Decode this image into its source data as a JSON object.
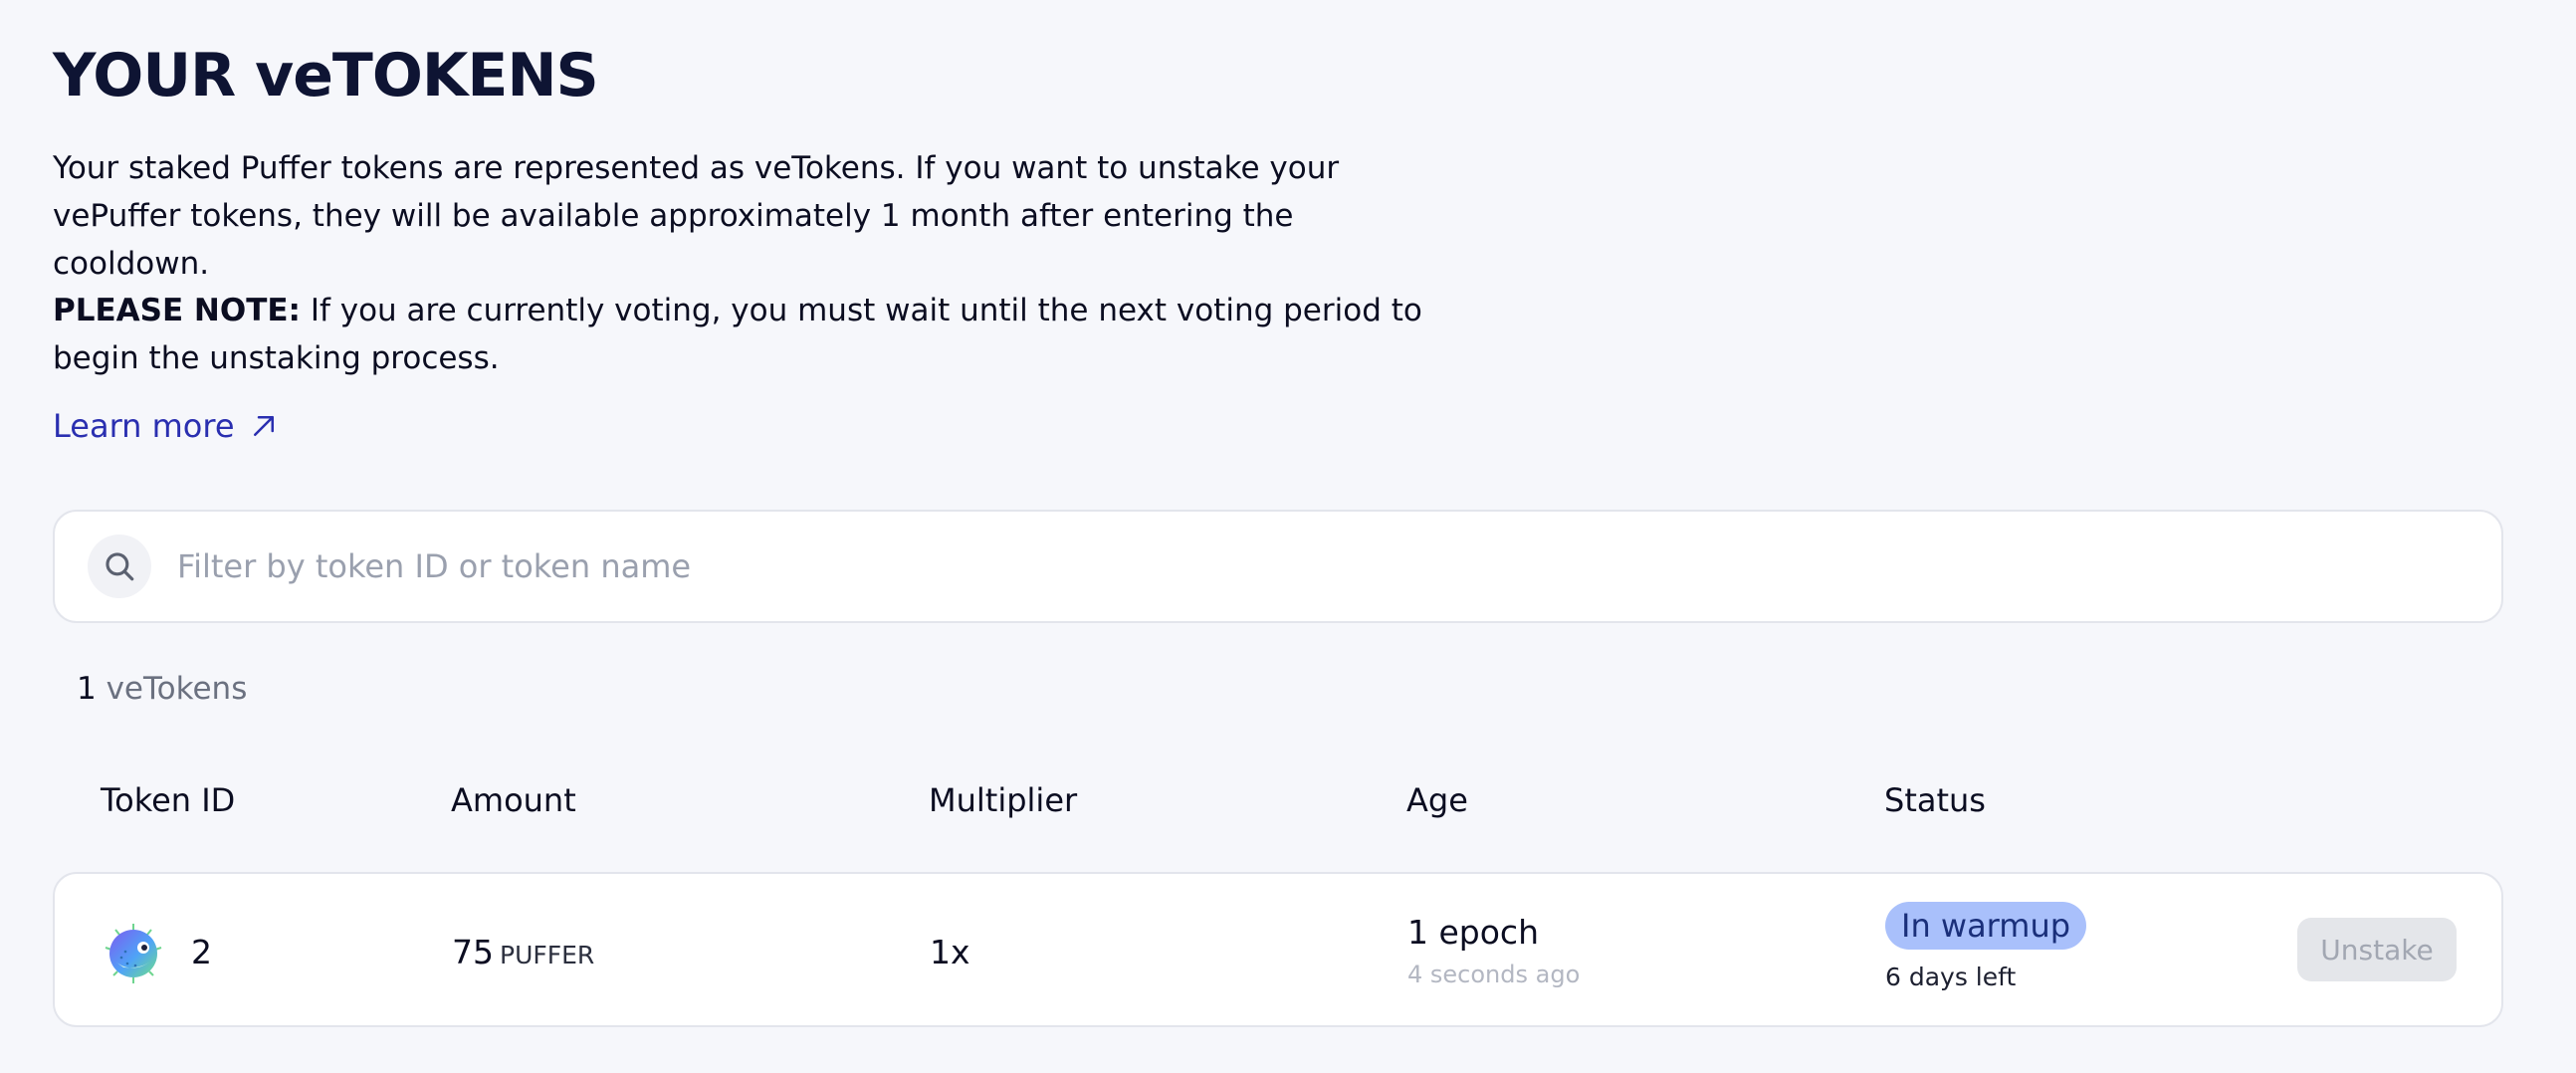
{
  "header": {
    "title": "YOUR veTOKENS",
    "description": "Your staked Puffer tokens are represented as veTokens. If you want to unstake your vePuffer tokens, they will be available approximately 1 month after entering the cooldown.",
    "note_label": "PLEASE NOTE:",
    "note_text": " If you are currently voting, you must wait until the next voting period to begin the unstaking process.",
    "learn_more": "Learn more"
  },
  "search": {
    "placeholder": "Filter by token ID or token name",
    "value": ""
  },
  "summary": {
    "count": "1",
    "count_label": " veTokens"
  },
  "table": {
    "columns": [
      "Token ID",
      "Amount",
      "Multiplier",
      "Age",
      "Status"
    ],
    "rows": [
      {
        "token_id": "2",
        "amount": "75",
        "unit": "PUFFER",
        "multiplier": "1x",
        "age": "1 epoch",
        "age_sub": "4 seconds ago",
        "status": "In warmup",
        "status_sub": "6 days left",
        "action": "Unstake"
      }
    ]
  },
  "colors": {
    "background": "#f6f7fb",
    "link": "#2a2fb0",
    "badge_bg": "#a9c0fb",
    "badge_text": "#1a2f7a"
  },
  "icons": [
    "arrow-up-right-icon",
    "search-icon",
    "puffer-avatar-icon"
  ]
}
